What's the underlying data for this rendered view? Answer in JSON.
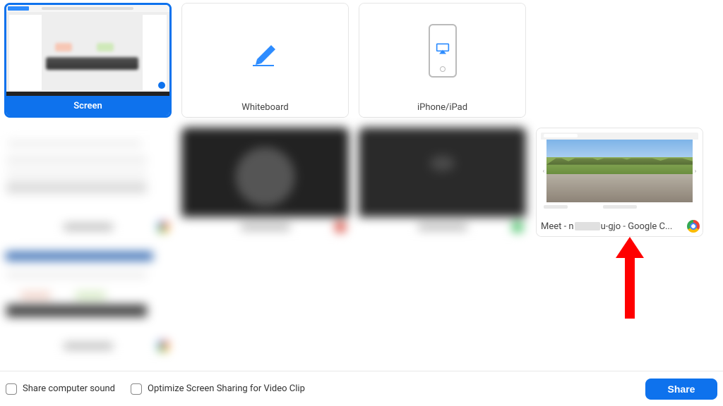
{
  "tiles": {
    "screen": {
      "label": "Screen"
    },
    "whiteboard": {
      "label": "Whiteboard"
    },
    "iphone": {
      "label": "iPhone/iPad"
    },
    "meet": {
      "label_pre": "Meet - n",
      "label_post": "u-gjo - Google C..."
    }
  },
  "footer": {
    "share_sound": "Share computer sound",
    "optimize_clip": "Optimize Screen Sharing for Video Clip",
    "share_button": "Share"
  },
  "colors": {
    "accent": "#0e72ed",
    "annotation": "#ff0000"
  }
}
